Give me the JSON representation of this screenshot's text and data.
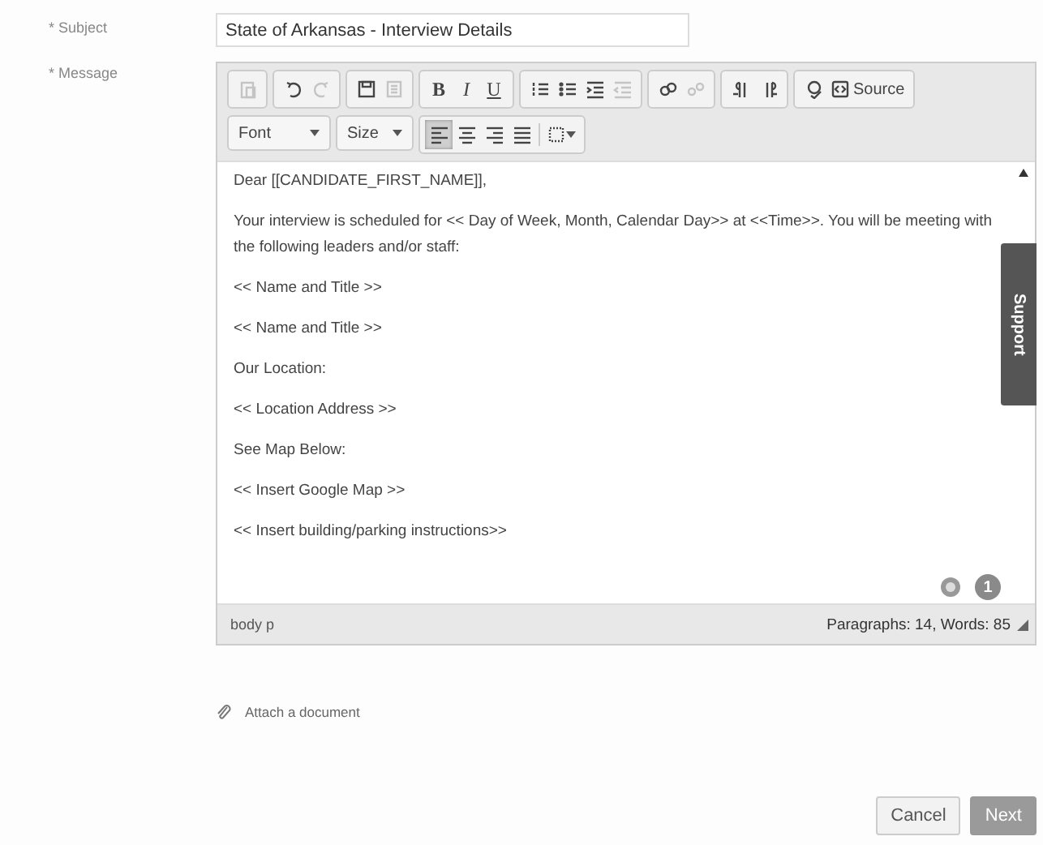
{
  "subject": {
    "label": "* Subject",
    "value": "State of Arkansas - Interview Details"
  },
  "message": {
    "label": "* Message"
  },
  "toolbar_row_1": [
    {
      "kind": "paste",
      "disabled": true
    },
    {
      "kind": "undo",
      "disabled": false
    },
    {
      "kind": "redo",
      "disabled": true
    },
    {
      "kind": "save",
      "disabled": false
    },
    {
      "kind": "template",
      "disabled": true
    },
    {
      "kind": "bold",
      "label": "B",
      "disabled": false
    },
    {
      "kind": "italic",
      "label": "I",
      "disabled": false
    },
    {
      "kind": "underline",
      "label": "U",
      "disabled": false
    },
    {
      "kind": "numbered",
      "disabled": false
    },
    {
      "kind": "bulleted",
      "disabled": false
    },
    {
      "kind": "indent",
      "disabled": false
    },
    {
      "kind": "outdent",
      "disabled": true
    },
    {
      "kind": "link",
      "disabled": false
    },
    {
      "kind": "unlink",
      "disabled": true
    },
    {
      "kind": "ltr",
      "disabled": false
    },
    {
      "kind": "rtl",
      "disabled": false
    },
    {
      "kind": "spell",
      "disabled": false
    },
    {
      "kind": "source",
      "label": "Source",
      "disabled": false
    }
  ],
  "toolbar_row_2": {
    "font": "Font",
    "size": "Size",
    "align": [
      {
        "kind": "left",
        "selected": true
      },
      {
        "kind": "center",
        "selected": false
      },
      {
        "kind": "right",
        "selected": false
      },
      {
        "kind": "justify",
        "selected": false
      }
    ]
  },
  "body": [
    "Dear [[CANDIDATE_FIRST_NAME]],",
    "Your interview is scheduled for << Day of Week, Month, Calendar Day>> at <<Time>>.  You will be meeting with the following leaders and/or staff:",
    "<< Name and Title >>",
    "<< Name and Title >>",
    "Our Location:",
    "<< Location Address >>",
    "See Map Below:",
    "<< Insert Google Map >>",
    "<< Insert building/parking instructions>>"
  ],
  "badge": "1",
  "status_bar": {
    "path": "body  p",
    "counts": "Paragraphs: 14, Words: 85"
  },
  "support_tab": "Support",
  "attach_link": "Attach a document",
  "buttons": [
    {
      "kind": "cancel",
      "label": "Cancel"
    },
    {
      "kind": "next",
      "label": "Next"
    }
  ]
}
